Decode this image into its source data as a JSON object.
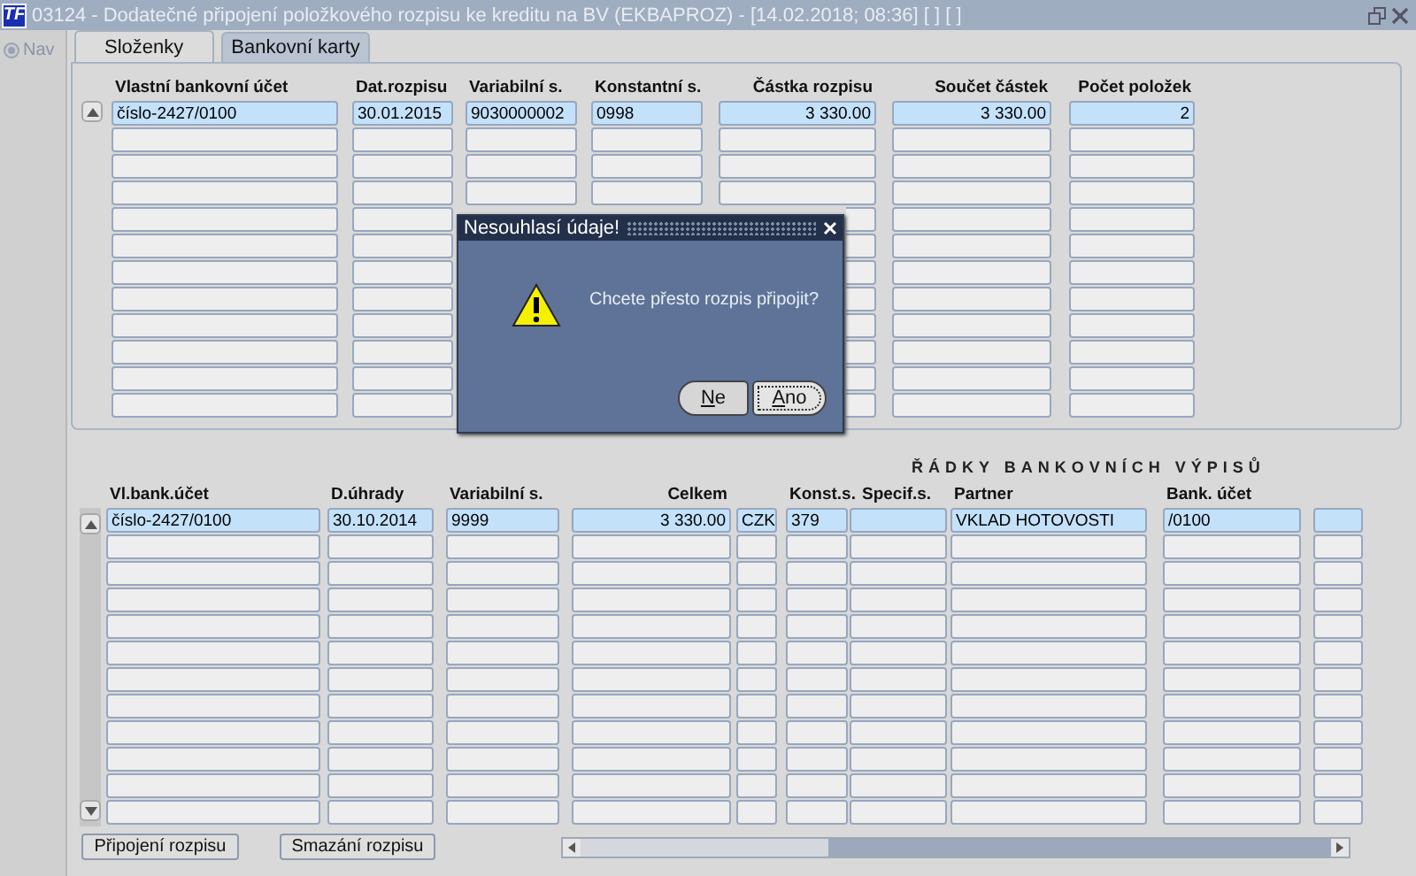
{
  "window": {
    "logo": "TF",
    "title": "03124 - Dodatečné připojení položkového rozpisu ke kreditu na BV (EKBAPROZ) - [14.02.2018; 08:36] [ ] [ ]"
  },
  "nav": {
    "label": "Nav"
  },
  "tabs": [
    {
      "label": "Složenky",
      "selected": true
    },
    {
      "label": "Bankovní karty",
      "selected": false
    }
  ],
  "upper_table": {
    "columns": [
      {
        "label": "Vlastní bankovní účet"
      },
      {
        "label": "Dat.rozpisu"
      },
      {
        "label": "Variabilní s."
      },
      {
        "label": "Konstantní s."
      },
      {
        "label": "Částka rozpisu"
      },
      {
        "label": "Součet částek"
      },
      {
        "label": "Počet položek"
      }
    ],
    "rows": [
      {
        "selected": true,
        "cells": [
          "číslo-2427/0100",
          "30.01.2015",
          "9030000002",
          "0998",
          "3 330.00",
          "3 330.00",
          "2"
        ]
      }
    ]
  },
  "lower_table": {
    "title": "ŘÁDKY BANKOVNÍCH VÝPISŮ",
    "columns": [
      {
        "label": "Vl.bank.účet"
      },
      {
        "label": "D.úhrady"
      },
      {
        "label": "Variabilní s."
      },
      {
        "label": "Celkem"
      },
      {},
      {
        "label": "Konst.s."
      },
      {
        "label": "Specif.s."
      },
      {
        "label": "Partner"
      },
      {
        "label": "Bank. účet"
      },
      {}
    ],
    "rows": [
      {
        "selected": true,
        "cells": [
          "číslo-2427/0100",
          "30.10.2014",
          "9999",
          "3 330.00",
          "CZK",
          "379",
          null,
          "VKLAD HOTOVOSTI",
          "/0100",
          null
        ]
      }
    ]
  },
  "buttons": [
    {
      "label": "Připojení rozpisu"
    },
    {
      "label": "Smazání rozpisu"
    }
  ],
  "dialog": {
    "title": "Nesouhlasí údaje!",
    "message": "Chcete přesto rozpis připojit?",
    "buttons": [
      {
        "label": "Ne",
        "focused": false
      },
      {
        "label": "Ano",
        "focused": true
      }
    ]
  }
}
